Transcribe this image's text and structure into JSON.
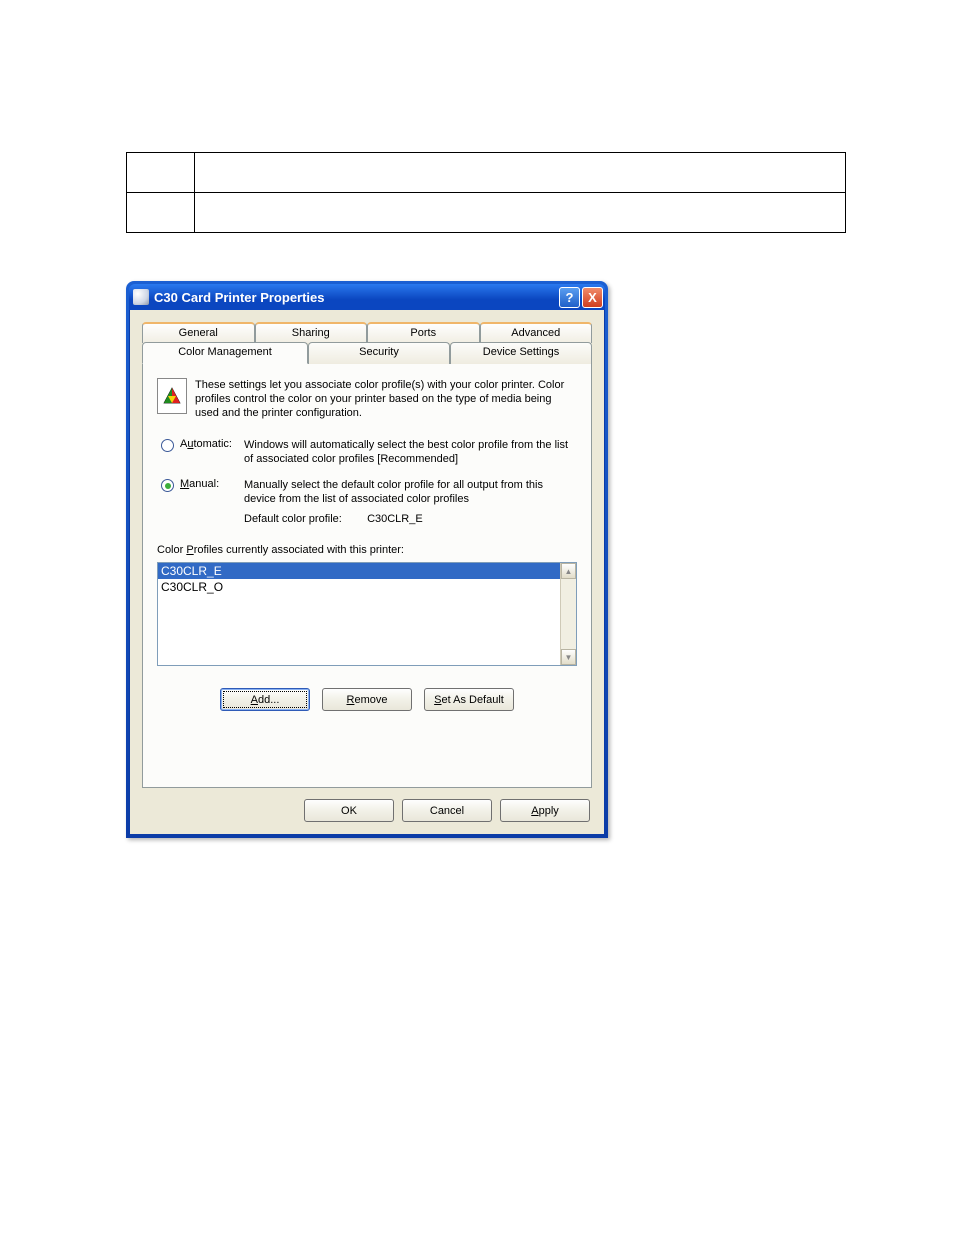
{
  "titlebar": {
    "title": "C30 Card Printer Properties",
    "help_symbol": "?",
    "close_symbol": "X"
  },
  "tabs": {
    "back_row": [
      {
        "label": "General"
      },
      {
        "label": "Sharing"
      },
      {
        "label": "Ports"
      },
      {
        "label": "Advanced"
      }
    ],
    "front_row": [
      {
        "label": "Color Management",
        "active": true
      },
      {
        "label": "Security"
      },
      {
        "label": "Device Settings"
      }
    ]
  },
  "panel": {
    "description": "These settings let you associate color profile(s) with your color printer. Color profiles control the color on your printer based on the type of media being used and the printer configuration.",
    "automatic": {
      "label": "Automatic:",
      "desc": "Windows will automatically select the best color profile from the list of associated color profiles [Recommended]"
    },
    "manual": {
      "label": "Manual:",
      "desc": "Manually select the default color profile for all output from this device from the list of associated color profiles",
      "default_label": "Default color profile:",
      "default_value": "C30CLR_E"
    },
    "profiles_label": "Color Profiles currently associated with this printer:",
    "profiles": [
      {
        "name": "C30CLR_E",
        "selected": true
      },
      {
        "name": "C30CLR_O",
        "selected": false
      }
    ],
    "buttons": {
      "add": "Add...",
      "remove": "Remove",
      "set_default": "Set As Default"
    }
  },
  "dialog_buttons": {
    "ok": "OK",
    "cancel": "Cancel",
    "apply": "Apply"
  }
}
